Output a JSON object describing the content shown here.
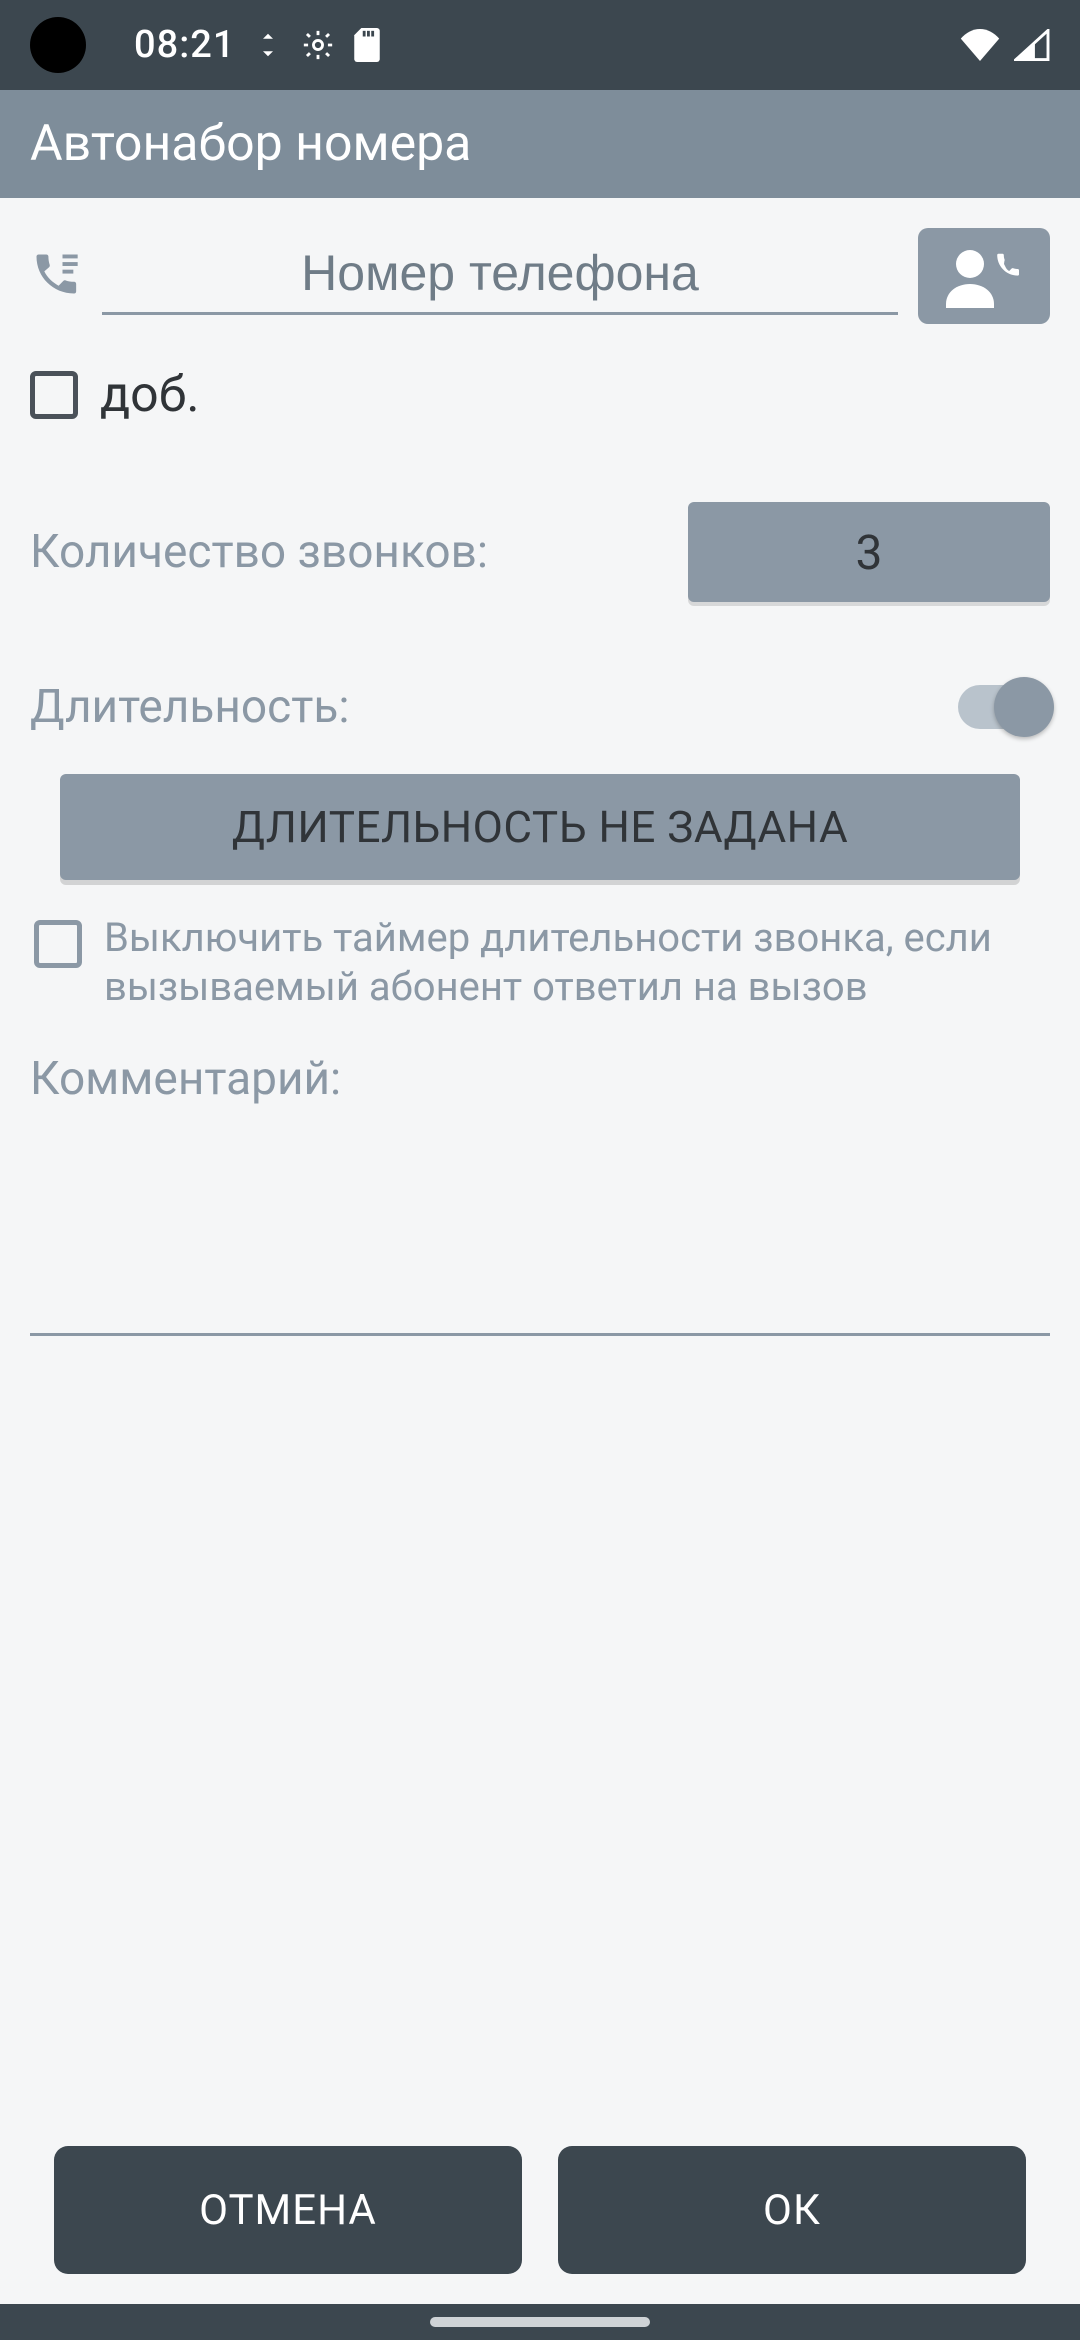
{
  "status": {
    "time": "08:21"
  },
  "app_bar": {
    "title": "Автонабор номера"
  },
  "phone": {
    "placeholder": "Номер телефона",
    "value": ""
  },
  "extension": {
    "label": "доб.",
    "checked": false
  },
  "call_count": {
    "label": "Количество звонков:",
    "value": "3"
  },
  "duration": {
    "label": "Длительность:",
    "toggle_on": true,
    "button_label": "ДЛИТЕЛЬНОСТЬ НЕ ЗАДАНА",
    "disable_timer_label": "Выключить таймер длительности звонка, если вызываемый абонент ответил на вызов",
    "disable_timer_checked": false
  },
  "comment": {
    "label": "Комментарий:",
    "value": ""
  },
  "footer": {
    "cancel": "ОТМЕНА",
    "ok": "ОК"
  }
}
